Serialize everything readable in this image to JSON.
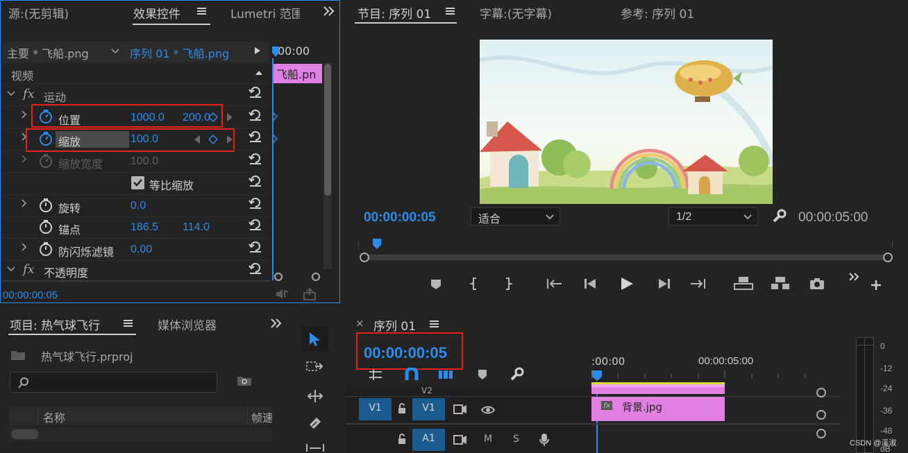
{
  "source_panel": {
    "tab_source": "源:(无剪辑)",
    "tab_effect_controls": "效果控件",
    "tab_lumetri": "Lumetri 范围",
    "master_label": "主要 * 飞船.png",
    "sequence_clip": "序列 01 * 飞船.png",
    "mini_timecode": "00:00",
    "clip_name": "飞船.pn",
    "section_video": "视频",
    "motion_label": "运动",
    "position_label": "位置",
    "position_x": "1000.0",
    "position_y": "200.0",
    "scale_label": "缩放",
    "scale_value": "100.0",
    "scale_width_label": "缩放宽度",
    "scale_width_value": "100.0",
    "uniform_scale_label": "等比缩放",
    "rotation_label": "旋转",
    "rotation_value": "0.0",
    "anchor_label": "锚点",
    "anchor_x": "186.5",
    "anchor_y": "114.0",
    "antiflicker_label": "防闪烁滤镜",
    "antiflicker_value": "0.00",
    "opacity_label": "不透明度",
    "bottom_timecode": "00:00:00:05"
  },
  "program_panel": {
    "tab_program": "节目: 序列 01",
    "tab_captions": "字幕:(无字幕)",
    "tab_reference": "参考: 序列 01",
    "current_timecode": "00:00:00:05",
    "fit_option": "适合",
    "resolution_option": "1/2",
    "duration": "00:00:05:00"
  },
  "project_panel": {
    "tab_project": "项目: 热气球飞行",
    "tab_media_browser": "媒体浏览器",
    "project_file": "热气球飞行.prproj",
    "search_placeholder": "",
    "column_name": "名称",
    "column_framerate": "帧速"
  },
  "timeline_panel": {
    "tab_sequence": "序列 01",
    "timecode": "00:00:00:05",
    "ruler_start": ":00:00",
    "ruler_mark": "00:00:05:00",
    "track_v2": "V2",
    "track_v1_src": "V1",
    "track_v1": "V1",
    "track_a1": "A1",
    "mute_label": "M",
    "solo_label": "S",
    "clip_background": "背景.jpg",
    "clip_fx": "fx"
  },
  "audio_meter": {
    "labels": [
      "0",
      "-12",
      "-24",
      "-36",
      "-48",
      "dB"
    ]
  },
  "watermark": "CSDN @溪淑",
  "colors": {
    "accent_blue": "#2d8ceb",
    "clip_pink": "#e27fe2",
    "highlight_red": "#e8201c",
    "track_blue": "#1c5b8e"
  }
}
